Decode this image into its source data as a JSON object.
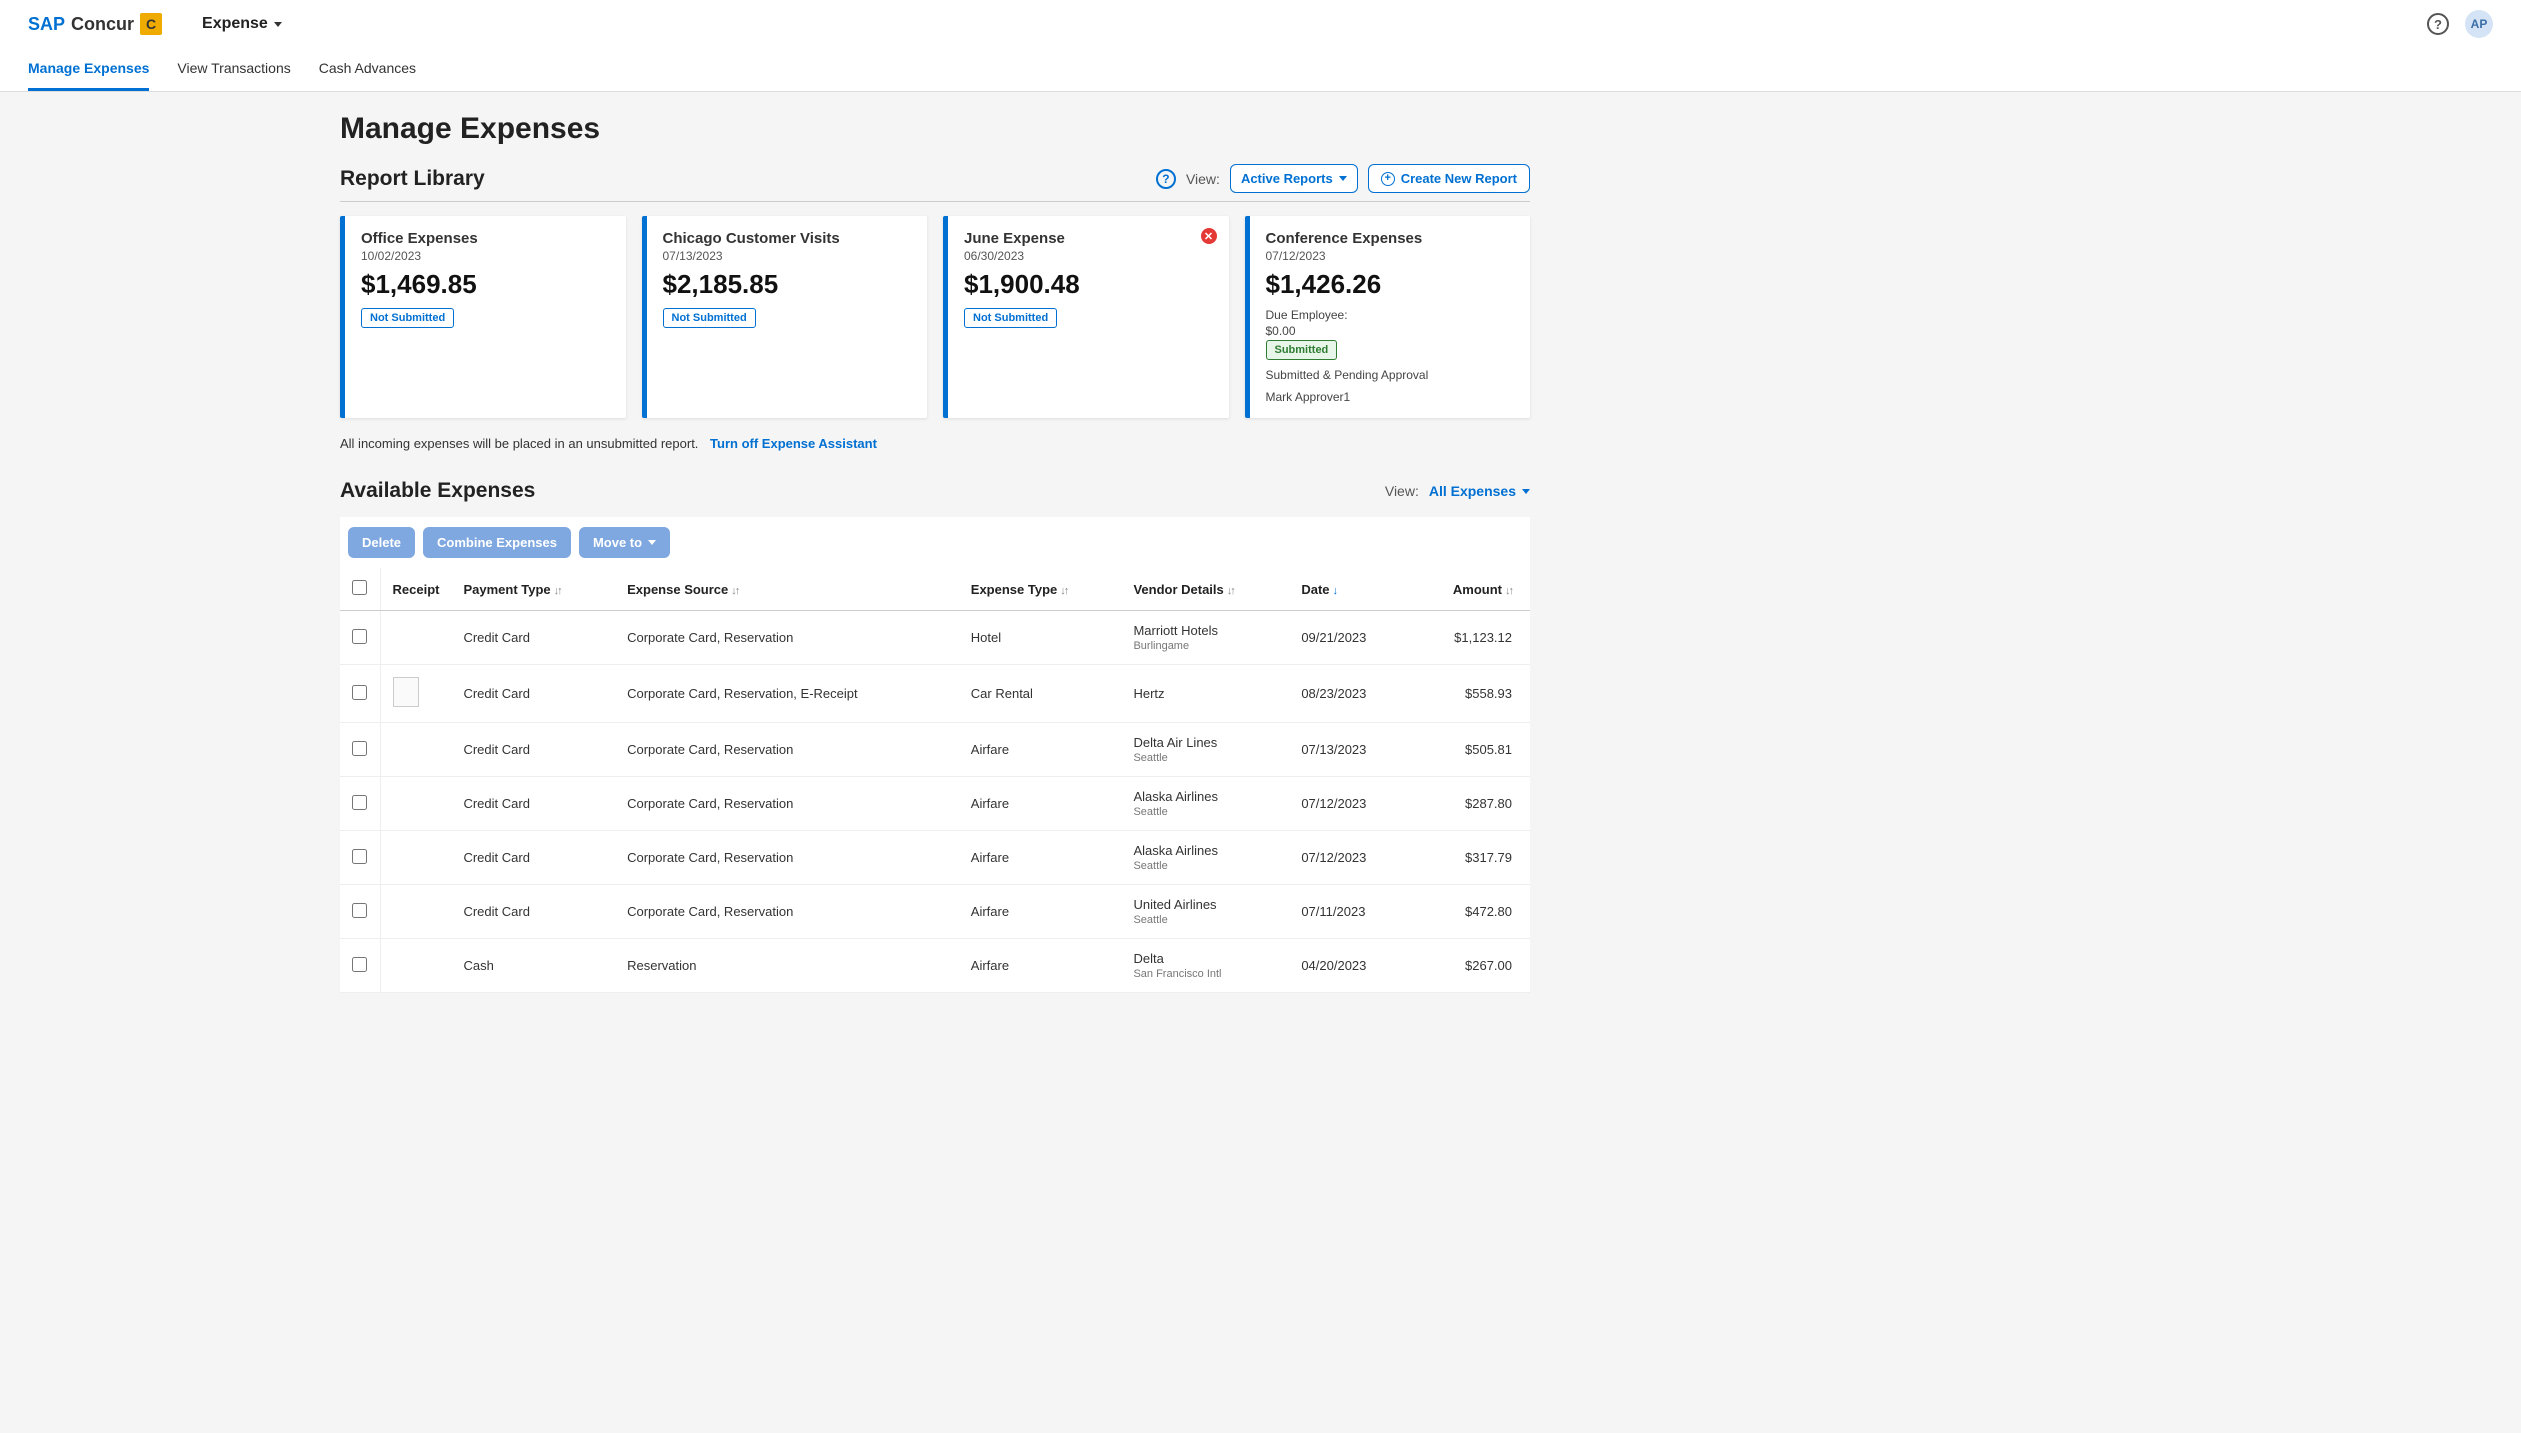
{
  "brand": {
    "sap": "SAP",
    "concur": "Concur",
    "badge": "C"
  },
  "nav": {
    "expense": "Expense"
  },
  "topbar": {
    "avatar": "AP"
  },
  "subnav": {
    "manage": "Manage Expenses",
    "view_tx": "View Transactions",
    "cash_adv": "Cash Advances"
  },
  "page_title": "Manage Expenses",
  "report_library": {
    "title": "Report Library",
    "view_label": "View:",
    "active_reports": "Active Reports",
    "create_btn": "Create New Report"
  },
  "cards": [
    {
      "title": "Office Expenses",
      "date": "10/02/2023",
      "amount": "$1,469.85",
      "status": "Not Submitted"
    },
    {
      "title": "Chicago Customer Visits",
      "date": "07/13/2023",
      "amount": "$2,185.85",
      "status": "Not Submitted"
    },
    {
      "title": "June Expense",
      "date": "06/30/2023",
      "amount": "$1,900.48",
      "status": "Not Submitted",
      "error": true
    },
    {
      "title": "Conference Expenses",
      "date": "07/12/2023",
      "amount": "$1,426.26",
      "due_label": "Due Employee:",
      "due_amount": "$0.00",
      "status": "Submitted",
      "footer1": "Submitted & Pending Approval",
      "footer2": "Mark Approver1"
    }
  ],
  "assistant": {
    "text": "All incoming expenses will be placed in an unsubmitted report.",
    "link": "Turn off Expense Assistant"
  },
  "available": {
    "title": "Available Expenses",
    "view_label": "View:",
    "all_expenses": "All Expenses",
    "actions": {
      "delete": "Delete",
      "combine": "Combine Expenses",
      "move": "Move to"
    },
    "columns": {
      "receipt": "Receipt",
      "payment_type": "Payment Type",
      "expense_source": "Expense Source",
      "expense_type": "Expense Type",
      "vendor": "Vendor Details",
      "date": "Date",
      "amount": "Amount"
    },
    "rows": [
      {
        "payment": "Credit Card",
        "source": "Corporate Card, Reservation",
        "type": "Hotel",
        "vendor": "Marriott Hotels",
        "vendor_sub": "Burlingame",
        "date": "09/21/2023",
        "amount": "$1,123.12",
        "receipt": false
      },
      {
        "payment": "Credit Card",
        "source": "Corporate Card, Reservation, E-Receipt",
        "type": "Car Rental",
        "vendor": "Hertz",
        "vendor_sub": "",
        "date": "08/23/2023",
        "amount": "$558.93",
        "receipt": true
      },
      {
        "payment": "Credit Card",
        "source": "Corporate Card, Reservation",
        "type": "Airfare",
        "vendor": "Delta Air Lines",
        "vendor_sub": "Seattle",
        "date": "07/13/2023",
        "amount": "$505.81",
        "receipt": false
      },
      {
        "payment": "Credit Card",
        "source": "Corporate Card, Reservation",
        "type": "Airfare",
        "vendor": "Alaska Airlines",
        "vendor_sub": "Seattle",
        "date": "07/12/2023",
        "amount": "$287.80",
        "receipt": false
      },
      {
        "payment": "Credit Card",
        "source": "Corporate Card, Reservation",
        "type": "Airfare",
        "vendor": "Alaska Airlines",
        "vendor_sub": "Seattle",
        "date": "07/12/2023",
        "amount": "$317.79",
        "receipt": false
      },
      {
        "payment": "Credit Card",
        "source": "Corporate Card, Reservation",
        "type": "Airfare",
        "vendor": "United Airlines",
        "vendor_sub": "Seattle",
        "date": "07/11/2023",
        "amount": "$472.80",
        "receipt": false
      },
      {
        "payment": "Cash",
        "source": "Reservation",
        "type": "Airfare",
        "vendor": "Delta",
        "vendor_sub": "San Francisco Intl",
        "date": "04/20/2023",
        "amount": "$267.00",
        "receipt": false
      }
    ]
  }
}
